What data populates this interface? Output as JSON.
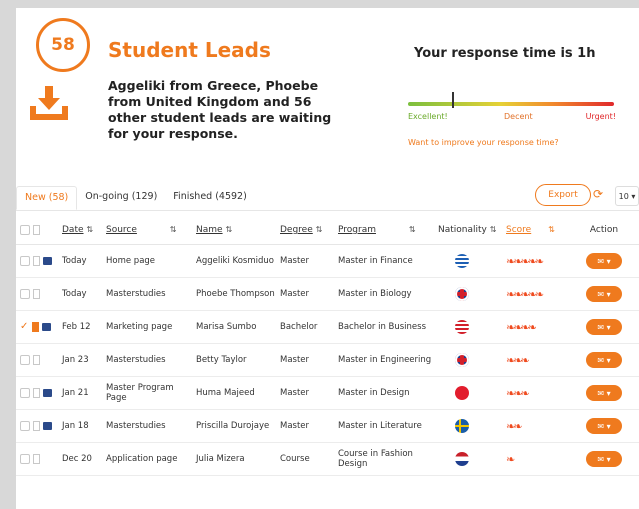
{
  "header": {
    "count": "58",
    "title": "Student Leads",
    "description": "Aggeliki from Greece, Phoebe from United Kingdom and 56 other student leads are waiting for your response."
  },
  "response": {
    "title": "Your response time is 1h",
    "excellent": "Excellent!",
    "decent": "Decent",
    "urgent": "Urgent!",
    "improve": "Want to improve your response time?"
  },
  "tabs": [
    {
      "label": "New (58)"
    },
    {
      "label": "On-going (129)"
    },
    {
      "label": "Finished (4592)"
    }
  ],
  "toolbar": {
    "export": "Export",
    "per_page": "10 ▾"
  },
  "columns": {
    "date": "Date",
    "source": "Source",
    "name": "Name",
    "degree": "Degree",
    "program": "Program",
    "nationality": "Nationality",
    "score": "Score",
    "action": "Action"
  },
  "rows": [
    {
      "date": "Today",
      "source": "Home page",
      "name": "Aggeliki Kosmiduo",
      "degree": "Master",
      "program": "Master in Finance",
      "flag": "greece",
      "score": "❧❧❧❧❧",
      "checked": false,
      "bookmarked": false,
      "message": true
    },
    {
      "date": "Today",
      "source": "Masterstudies",
      "name": "Phoebe Thompson",
      "degree": "Master",
      "program": "Master in Biology",
      "flag": "uk",
      "score": "❧❧❧❧❧",
      "checked": false,
      "bookmarked": false,
      "message": false
    },
    {
      "date": "Feb 12",
      "source": "Marketing page",
      "name": "Marisa Sumbo",
      "degree": "Bachelor",
      "program": "Bachelor in Business",
      "flag": "usa",
      "score": "❧❧❧❧",
      "checked": true,
      "bookmarked": true,
      "message": true
    },
    {
      "date": "Jan 23",
      "source": "Masterstudies",
      "name": "Betty Taylor",
      "degree": "Master",
      "program": "Master in Engineering",
      "flag": "uk",
      "score": "❧❧❧",
      "checked": false,
      "bookmarked": false,
      "message": false
    },
    {
      "date": "Jan 21",
      "source": "Master Program Page",
      "name": "Huma Majeed",
      "degree": "Master",
      "program": "Master in Design",
      "flag": "turkey",
      "score": "❧❧❧",
      "checked": false,
      "bookmarked": false,
      "message": true
    },
    {
      "date": "Jan 18",
      "source": "Masterstudies",
      "name": "Priscilla Durojaye",
      "degree": "Master",
      "program": "Master in Literature",
      "flag": "sweden",
      "score": "❧❧",
      "checked": false,
      "bookmarked": false,
      "message": true
    },
    {
      "date": "Dec 20",
      "source": "Application page",
      "name": "Julia Mizera",
      "degree": "Course",
      "program": "Course in Fashion Design",
      "flag": "netherlands",
      "score": "❧",
      "checked": false,
      "bookmarked": false,
      "message": false
    }
  ],
  "colors": {
    "accent": "#ef7a1e",
    "score": "#ef4b1f",
    "message": "#2b4a8a"
  }
}
